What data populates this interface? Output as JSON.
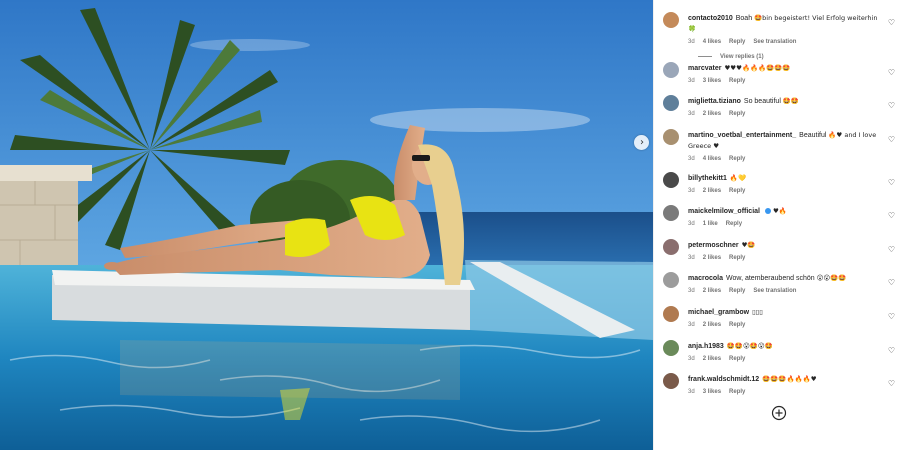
{
  "post": {
    "image_alt": "woman in yellow bikini lounging by infinity pool",
    "next_icon": "chevron-right-icon"
  },
  "comments": [
    {
      "user": "contacto2010",
      "text": "Boah",
      "emoji_after": "🤩bin begeistert! Viel Erfolg weiterhin 🍀",
      "time": "3d",
      "likes": "4 likes",
      "reply": "Reply",
      "translate": "See translation",
      "view_replies": "View replies (1)",
      "avatar_color": "#c48a5a"
    },
    {
      "user": "marcvater",
      "text": "",
      "emoji_after": "♥♥♥🔥🔥🔥🤩🤩🤩",
      "time": "3d",
      "likes": "3 likes",
      "reply": "Reply",
      "avatar_color": "#9aa6b8"
    },
    {
      "user": "miglietta.tiziano",
      "text": "So beautiful",
      "emoji_after": "🤩🤩",
      "time": "3d",
      "likes": "2 likes",
      "reply": "Reply",
      "avatar_color": "#5f7f9a"
    },
    {
      "user": "martino_voetbal_entertainment_",
      "text": "Beautiful",
      "emoji_after": "🔥♥ and I love Greece ♥",
      "time": "3d",
      "likes": "4 likes",
      "reply": "Reply",
      "avatar_color": "#a89070"
    },
    {
      "user": "billythekitt1",
      "text": "",
      "emoji_after": "🔥💛",
      "time": "3d",
      "likes": "2 likes",
      "reply": "Reply",
      "avatar_color": "#4a4a4a"
    },
    {
      "user": "maickelmilow_official",
      "text": "",
      "emoji_after": "♥🔥",
      "time": "3d",
      "likes": "1 like",
      "reply": "Reply",
      "avatar_color": "#7a7a7a",
      "verified": true
    },
    {
      "user": "petermoschner",
      "text": "",
      "emoji_after": "♥🤩",
      "time": "3d",
      "likes": "2 likes",
      "reply": "Reply",
      "avatar_color": "#8a6e6e"
    },
    {
      "user": "macrocola",
      "text": "Wow, atemberaubend schön",
      "emoji_after": "😮😮🤩🤩",
      "time": "3d",
      "likes": "2 likes",
      "reply": "Reply",
      "translate": "See translation",
      "avatar_color": "#9c9c9c"
    },
    {
      "user": "michael_grambow",
      "text": "",
      "emoji_after": "▯▯▯",
      "time": "3d",
      "likes": "2 likes",
      "reply": "Reply",
      "avatar_color": "#b07a50"
    },
    {
      "user": "anja.h1983",
      "text": "",
      "emoji_after": "🤩🤩😮🤩😮🤩",
      "time": "3d",
      "likes": "2 likes",
      "reply": "Reply",
      "avatar_color": "#6a8a5a"
    },
    {
      "user": "frank.waldschmidt.12",
      "text": "",
      "emoji_after": "🤩🤩🤩🔥🔥🔥♥",
      "time": "3d",
      "likes": "3 likes",
      "reply": "Reply",
      "avatar_color": "#7a5a4a"
    }
  ],
  "add_comment_icon": "plus-circle-icon",
  "like_icon": "heart-outline-icon"
}
